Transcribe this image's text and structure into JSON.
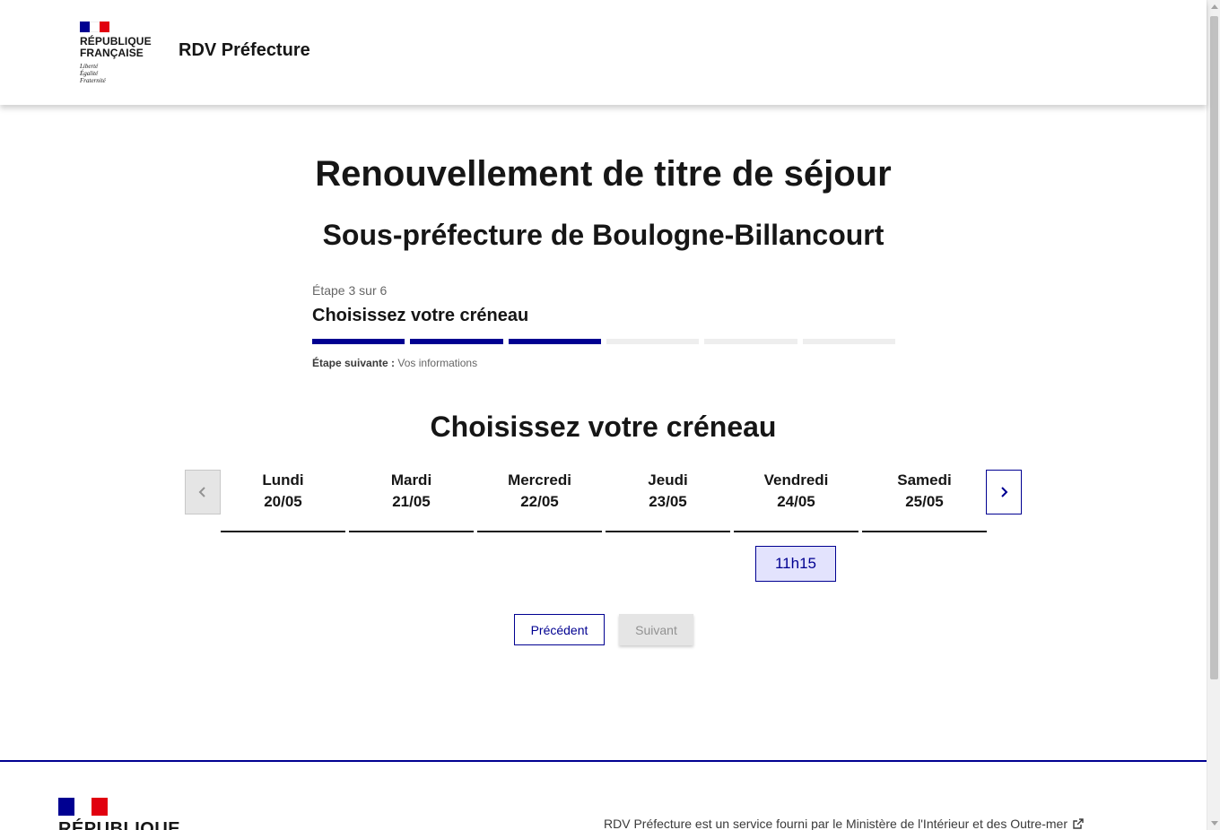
{
  "header": {
    "logo_line1": "République",
    "logo_line2": "Française",
    "motto1": "Liberté",
    "motto2": "Égalité",
    "motto3": "Fraternité",
    "site_name": "RDV Préfecture"
  },
  "main": {
    "title": "Renouvellement de titre de séjour",
    "subtitle": "Sous-préfecture de Boulogne-Billancourt"
  },
  "stepper": {
    "count": "Étape 3 sur 6",
    "title": "Choisissez votre créneau",
    "total_steps": 6,
    "current_step": 3,
    "next_label": "Étape suivante :",
    "next_value": "Vos informations"
  },
  "calendar": {
    "title": "Choisissez votre créneau",
    "days": [
      {
        "name": "Lundi",
        "date": "20/05"
      },
      {
        "name": "Mardi",
        "date": "21/05"
      },
      {
        "name": "Mercredi",
        "date": "22/05"
      },
      {
        "name": "Jeudi",
        "date": "23/05"
      },
      {
        "name": "Vendredi",
        "date": "24/05"
      },
      {
        "name": "Samedi",
        "date": "25/05"
      }
    ],
    "slot": "11h15"
  },
  "actions": {
    "previous": "Précédent",
    "next": "Suivant"
  },
  "footer": {
    "rf": "RÉPUBLIQUE",
    "service": "RDV Préfecture est un service fourni par le Ministère de l'Intérieur et des Outre-mer"
  },
  "colors": {
    "primary": "#000091",
    "red": "#e1000f",
    "slot_bg": "#e3e3fd"
  }
}
